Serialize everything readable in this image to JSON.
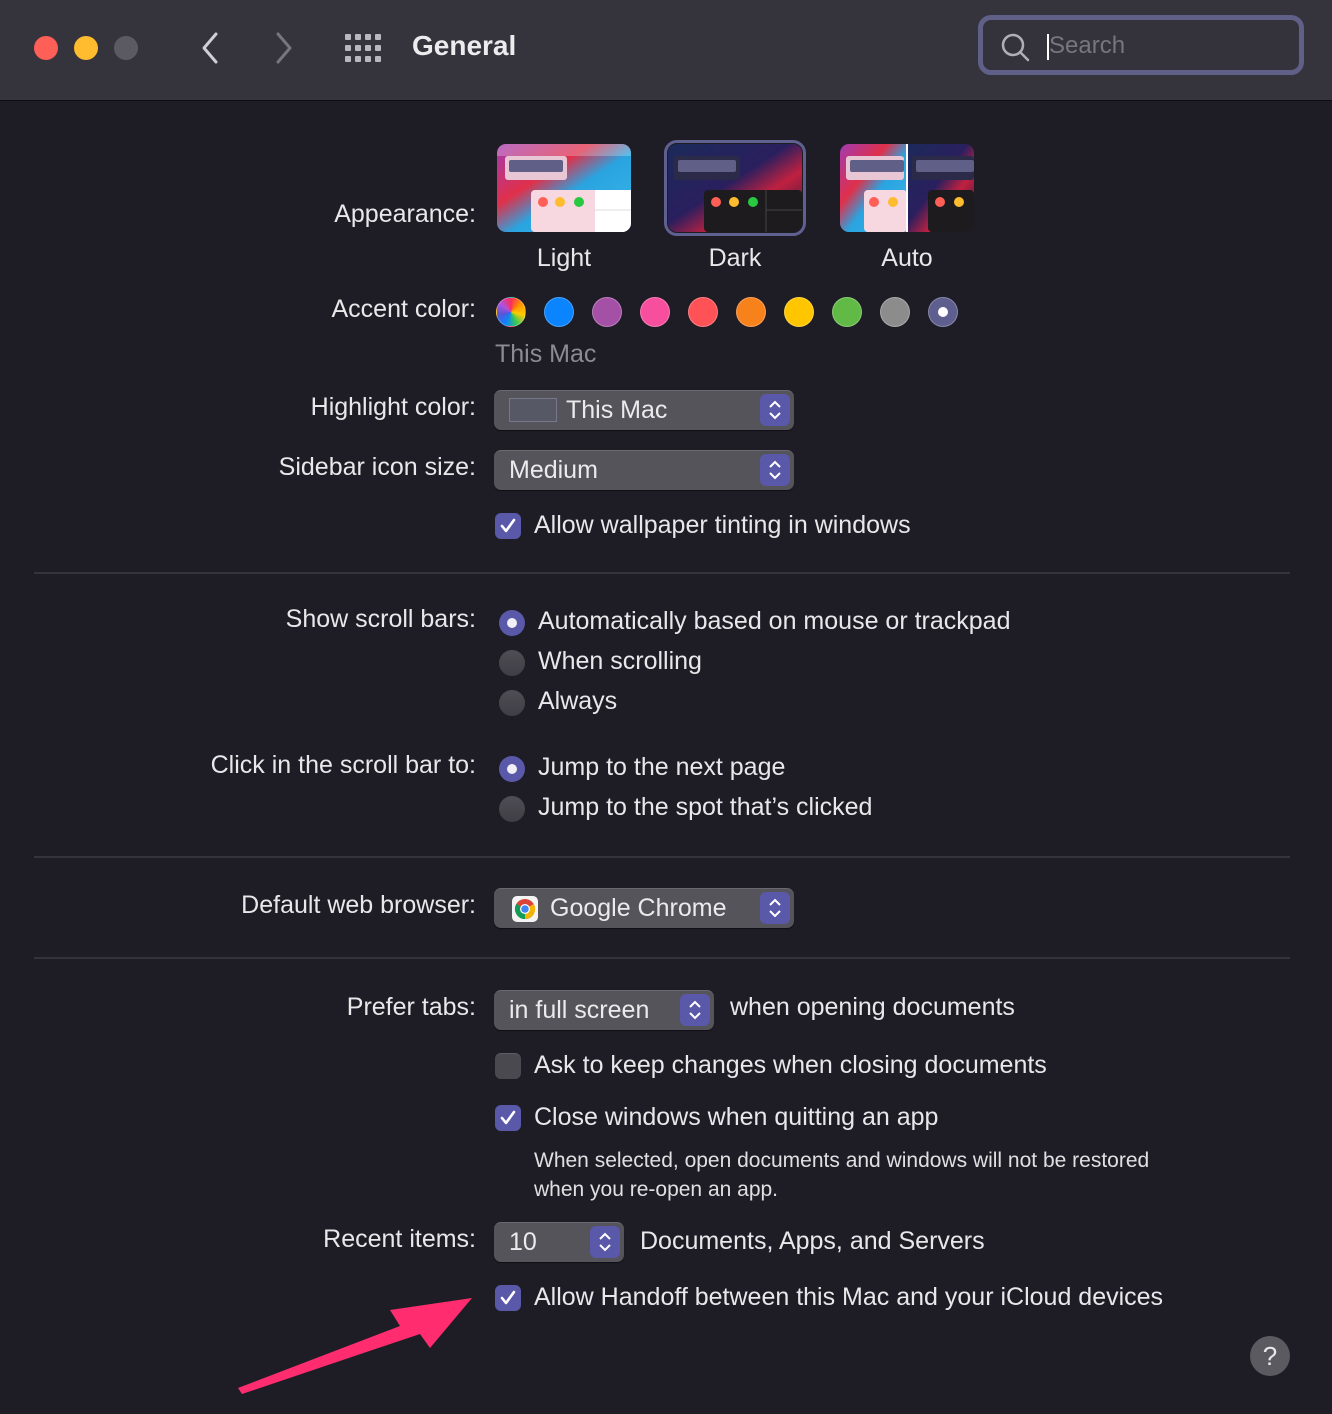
{
  "window": {
    "title": "General",
    "traffic_lights": [
      "close",
      "minimize",
      "zoom"
    ],
    "nav": {
      "back_icon": "chevron-left-icon",
      "forward_icon": "chevron-right-icon",
      "grid_icon": "show-all-grid-icon"
    },
    "search": {
      "placeholder": "Search",
      "value": ""
    }
  },
  "appearance": {
    "label": "Appearance:",
    "options": [
      {
        "name": "Light",
        "selected": false
      },
      {
        "name": "Dark",
        "selected": true
      },
      {
        "name": "Auto",
        "selected": false
      }
    ]
  },
  "accent": {
    "label": "Accent color:",
    "caption": "This Mac",
    "colors": [
      {
        "name": "multicolor",
        "hex": "multicolor"
      },
      {
        "name": "blue",
        "hex": "#0a84ff"
      },
      {
        "name": "purple",
        "hex": "#a550a7"
      },
      {
        "name": "pink",
        "hex": "#f74f9e"
      },
      {
        "name": "red",
        "hex": "#ff5257"
      },
      {
        "name": "orange",
        "hex": "#f7821b"
      },
      {
        "name": "yellow",
        "hex": "#ffc600"
      },
      {
        "name": "green",
        "hex": "#62ba46"
      },
      {
        "name": "graphite",
        "hex": "#8c8c8c"
      },
      {
        "name": "this-mac",
        "hex": "#5e5f8f",
        "selected": true
      }
    ]
  },
  "highlight": {
    "label": "Highlight color:",
    "value": "This Mac",
    "swatch": "#565866"
  },
  "sidebar_icon_size": {
    "label": "Sidebar icon size:",
    "value": "Medium"
  },
  "wallpaper_tinting": {
    "label": "Allow wallpaper tinting in windows",
    "checked": true
  },
  "scroll_bars": {
    "label": "Show scroll bars:",
    "options": [
      {
        "label": "Automatically based on mouse or trackpad",
        "selected": true
      },
      {
        "label": "When scrolling",
        "selected": false
      },
      {
        "label": "Always",
        "selected": false
      }
    ]
  },
  "click_scroll": {
    "label": "Click in the scroll bar to:",
    "options": [
      {
        "label": "Jump to the next page",
        "selected": true
      },
      {
        "label": "Jump to the spot that’s clicked",
        "selected": false
      }
    ]
  },
  "browser": {
    "label": "Default web browser:",
    "value": "Google Chrome",
    "icon": "chrome-icon"
  },
  "prefer_tabs": {
    "label": "Prefer tabs:",
    "value": "in full screen",
    "suffix": "when opening documents"
  },
  "ask_keep_changes": {
    "label": "Ask to keep changes when closing documents",
    "checked": false
  },
  "close_windows": {
    "label": "Close windows when quitting an app",
    "checked": true,
    "note_line1": "When selected, open documents and windows will not be restored",
    "note_line2": "when you re-open an app."
  },
  "recent_items": {
    "label": "Recent items:",
    "value": "10",
    "suffix": "Documents, Apps, and Servers"
  },
  "handoff": {
    "label": "Allow Handoff between this Mac and your iCloud devices",
    "checked": true
  },
  "help": {
    "label": "?"
  },
  "annotation": {
    "color": "#ff2d6f",
    "points_to": "handoff-checkbox"
  }
}
